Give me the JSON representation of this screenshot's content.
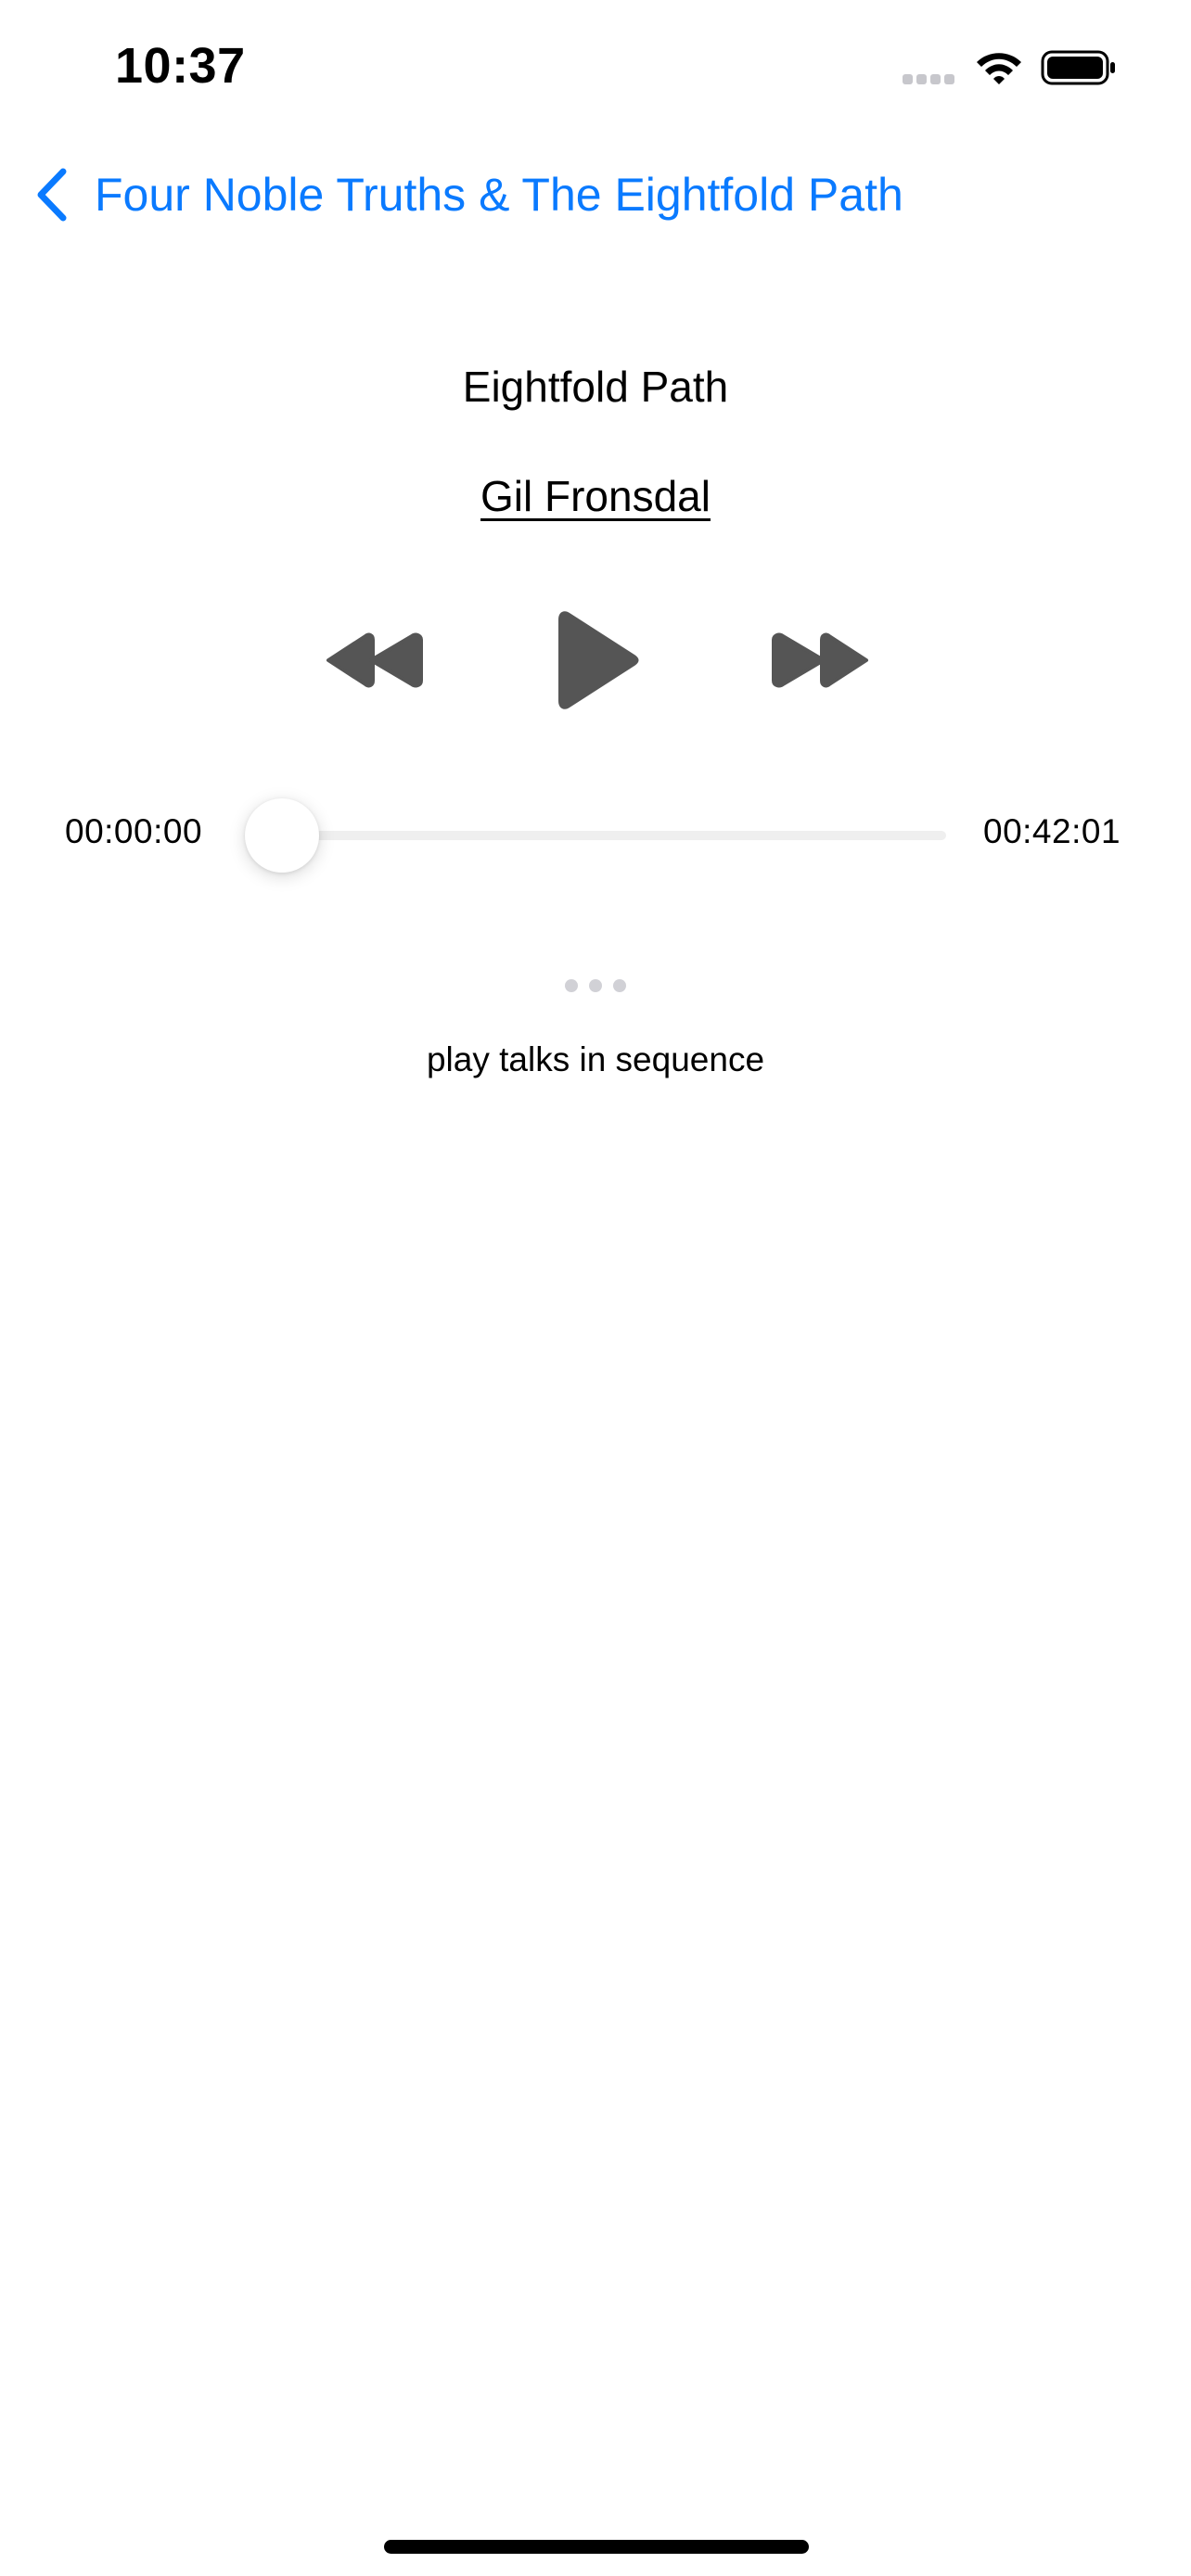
{
  "status_bar": {
    "time": "10:37",
    "signal_icon": "cellular-signal-icon",
    "wifi_icon": "wifi-icon",
    "battery_icon": "battery-full-icon"
  },
  "nav": {
    "back_icon": "chevron-left-icon",
    "back_label": "Four Noble Truths & The Eightfold Path",
    "accent_color": "#0a7aff"
  },
  "talk": {
    "title": "Eightfold Path",
    "speaker": "Gil Fronsdal"
  },
  "controls": {
    "rewind_icon": "rewind-icon",
    "play_icon": "play-icon",
    "forward_icon": "fast-forward-icon",
    "icon_color": "#555555"
  },
  "progress": {
    "elapsed": "00:00:00",
    "total": "00:42:01",
    "fraction": 0
  },
  "extras": {
    "more_icon": "ellipsis-icon",
    "sequence_label": "play talks in sequence"
  }
}
